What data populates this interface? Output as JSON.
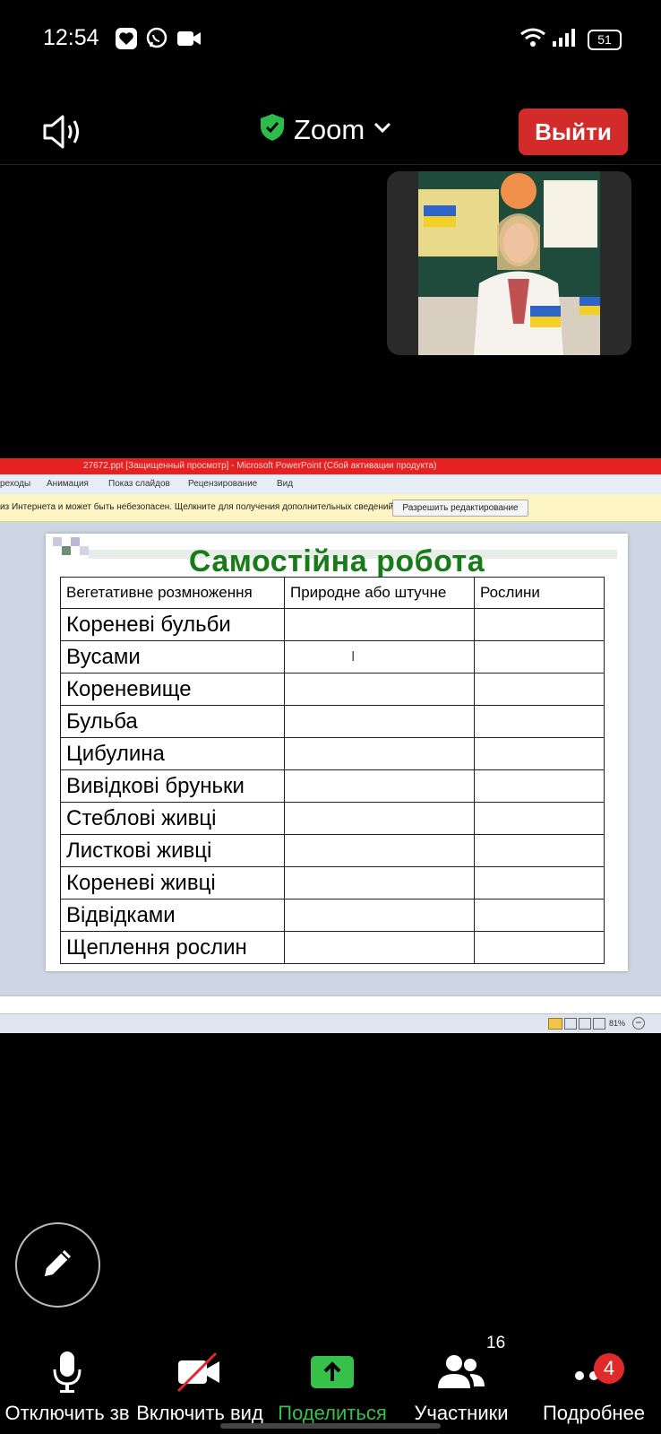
{
  "status_bar": {
    "time": "12:54",
    "battery": "51"
  },
  "header": {
    "app_name": "Zoom",
    "leave_label": "Выйти"
  },
  "ppt": {
    "window_title": "27672.ppt [Защищенный просмотр] - Microsoft PowerPoint (Сбой активации продукта)",
    "ribbon_tabs": [
      "реходы",
      "Анимация",
      "Показ слайдов",
      "Рецензирование",
      "Вид"
    ],
    "protected_msg": "из Интернета и может быть небезопасен. Щелкните для получения дополнительных сведений.",
    "enable_edit_label": "Разрешить редактирование",
    "zoom_level": "81%"
  },
  "slide": {
    "title": "Самостійна робота",
    "headers": [
      "Вегетативне розмноження",
      "Природне або штучне",
      "Рослини"
    ],
    "rows": [
      "Кореневі бульби",
      "Вусами",
      "Кореневище",
      "Бульба",
      "Цибулина",
      "Вивідкові бруньки",
      "Стеблові живці",
      "Листкові живці",
      "Кореневі живці",
      "Відвідками",
      "Щеплення рослин"
    ]
  },
  "toolbar": {
    "mute_label": "Отключить зв",
    "video_label": "Включить вид",
    "share_label": "Поделиться",
    "participants_label": "Участники",
    "participants_count": "16",
    "more_label": "Подробнее",
    "more_badge": "4"
  },
  "colors": {
    "leave_button": "#d32a2a",
    "share_green": "#37c04a",
    "slide_title_green": "#177b17",
    "ppt_titlebar_red": "#e52121",
    "badge_red": "#e02a2a"
  }
}
